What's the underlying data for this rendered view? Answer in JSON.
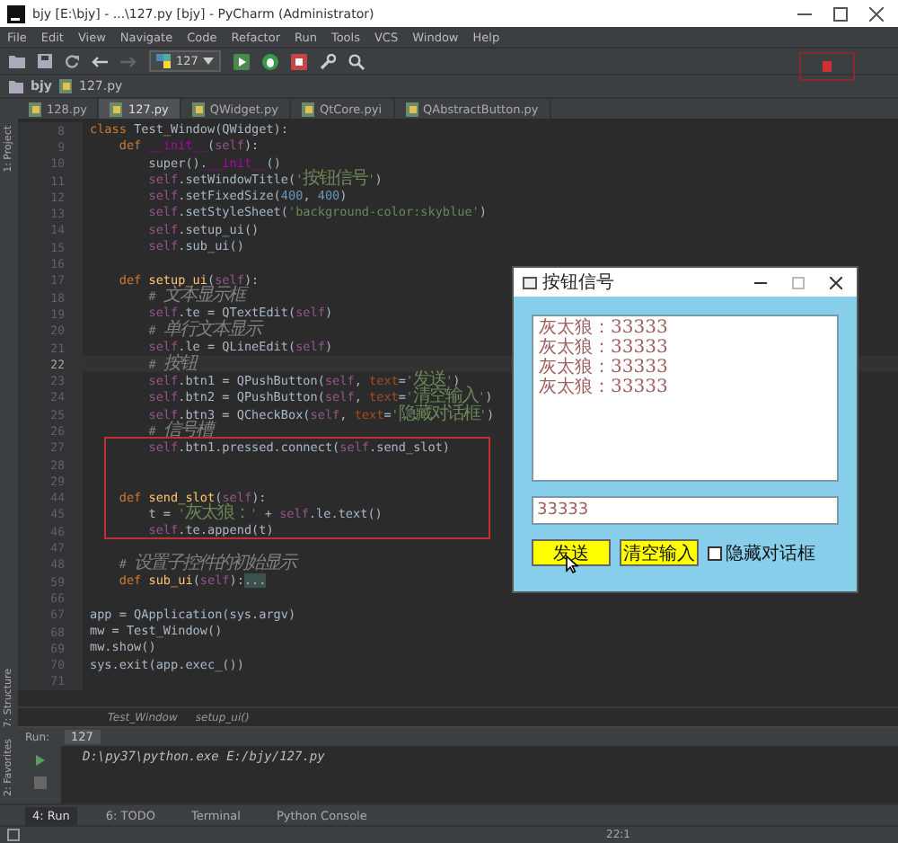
{
  "window": {
    "title": "bjy [E:\\bjy] - ...\\127.py [bjy] - PyCharm (Administrator)"
  },
  "menu": [
    "File",
    "Edit",
    "View",
    "Navigate",
    "Code",
    "Refactor",
    "Run",
    "Tools",
    "VCS",
    "Window",
    "Help"
  ],
  "toolbar": {
    "run_config": "127"
  },
  "navbar": [
    "bjy",
    "127.py"
  ],
  "tabs": [
    {
      "label": "128.py",
      "selected": false
    },
    {
      "label": "127.py",
      "selected": true
    },
    {
      "label": "QWidget.py",
      "selected": false
    },
    {
      "label": "QtCore.pyi",
      "selected": false
    },
    {
      "label": "QAbstractButton.py",
      "selected": false
    }
  ],
  "side_tools": [
    "1: Project",
    "7: Structure",
    "2: Favorites"
  ],
  "code": [
    {
      "num": "8",
      "current": false,
      "tokens": [
        {
          "kind": "kw",
          "text": "class "
        },
        {
          "kind": "plain",
          "text": "Test_Window(QWidget):"
        }
      ]
    },
    {
      "num": "9",
      "current": false,
      "tokens": [
        {
          "kind": "kw",
          "text": "    def "
        },
        {
          "kind": "magic",
          "text": "__init__"
        },
        {
          "kind": "plain",
          "text": "("
        },
        {
          "kind": "self",
          "text": "self"
        },
        {
          "kind": "plain",
          "text": "):"
        }
      ]
    },
    {
      "num": "10",
      "current": false,
      "tokens": [
        {
          "kind": "plain",
          "text": "        super()."
        },
        {
          "kind": "magic",
          "text": "__init__"
        },
        {
          "kind": "plain",
          "text": "()"
        }
      ]
    },
    {
      "num": "11",
      "current": false,
      "tokens": [
        {
          "kind": "self",
          "text": "        self"
        },
        {
          "kind": "plain",
          "text": ".setWindowTitle("
        },
        {
          "kind": "str",
          "text": "'按钮信号'"
        },
        {
          "kind": "plain",
          "text": ")"
        }
      ]
    },
    {
      "num": "12",
      "current": false,
      "tokens": [
        {
          "kind": "self",
          "text": "        self"
        },
        {
          "kind": "plain",
          "text": ".setFixedSize("
        },
        {
          "kind": "num",
          "text": "400"
        },
        {
          "kind": "plain",
          "text": ", "
        },
        {
          "kind": "num",
          "text": "400"
        },
        {
          "kind": "plain",
          "text": ")"
        }
      ]
    },
    {
      "num": "13",
      "current": false,
      "tokens": [
        {
          "kind": "self",
          "text": "        self"
        },
        {
          "kind": "plain",
          "text": ".setStyleSheet("
        },
        {
          "kind": "str",
          "text": "'background-color:skyblue'"
        },
        {
          "kind": "plain",
          "text": ")"
        }
      ]
    },
    {
      "num": "14",
      "current": false,
      "tokens": [
        {
          "kind": "self",
          "text": "        self"
        },
        {
          "kind": "plain",
          "text": ".setup_ui()"
        }
      ]
    },
    {
      "num": "15",
      "current": false,
      "tokens": [
        {
          "kind": "self",
          "text": "        self"
        },
        {
          "kind": "plain",
          "text": ".sub_ui()"
        }
      ]
    },
    {
      "num": "16",
      "current": false
    },
    {
      "num": "17",
      "current": false,
      "tokens": [
        {
          "kind": "kw",
          "text": "    def "
        },
        {
          "kind": "fn",
          "text": "setup_ui"
        },
        {
          "kind": "plain",
          "text": "("
        },
        {
          "kind": "self",
          "text": "self"
        },
        {
          "kind": "plain",
          "text": "):"
        }
      ]
    },
    {
      "num": "18",
      "current": false,
      "tokens": [
        {
          "kind": "cmt",
          "text": "        # 文本显示框"
        }
      ]
    },
    {
      "num": "19",
      "current": false,
      "tokens": [
        {
          "kind": "self",
          "text": "        self"
        },
        {
          "kind": "plain",
          "text": ".te = QTextEdit("
        },
        {
          "kind": "self",
          "text": "self"
        },
        {
          "kind": "plain",
          "text": ")"
        }
      ]
    },
    {
      "num": "20",
      "current": false,
      "tokens": [
        {
          "kind": "cmt",
          "text": "        # 单行文本显示"
        }
      ]
    },
    {
      "num": "21",
      "current": false,
      "tokens": [
        {
          "kind": "self",
          "text": "        self"
        },
        {
          "kind": "plain",
          "text": ".le = QLineEdit("
        },
        {
          "kind": "self",
          "text": "self"
        },
        {
          "kind": "plain",
          "text": ")"
        }
      ]
    },
    {
      "num": "22",
      "current": true,
      "tokens": [
        {
          "kind": "cmt",
          "text": "        # 按钮"
        }
      ]
    },
    {
      "num": "23",
      "current": false,
      "tokens": [
        {
          "kind": "self",
          "text": "        self"
        },
        {
          "kind": "plain",
          "text": ".btn1 = QPushButton("
        },
        {
          "kind": "self",
          "text": "self"
        },
        {
          "kind": "plain",
          "text": ", "
        },
        {
          "kind": "param",
          "text": "text"
        },
        {
          "kind": "plain",
          "text": "="
        },
        {
          "kind": "str",
          "text": "'发送'"
        },
        {
          "kind": "plain",
          "text": ")"
        }
      ]
    },
    {
      "num": "24",
      "current": false,
      "tokens": [
        {
          "kind": "self",
          "text": "        self"
        },
        {
          "kind": "plain",
          "text": ".btn2 = QPushButton("
        },
        {
          "kind": "self",
          "text": "self"
        },
        {
          "kind": "plain",
          "text": ", "
        },
        {
          "kind": "param",
          "text": "text"
        },
        {
          "kind": "plain",
          "text": "="
        },
        {
          "kind": "str",
          "text": "'清空输入'"
        },
        {
          "kind": "plain",
          "text": ")"
        }
      ]
    },
    {
      "num": "25",
      "current": false,
      "tokens": [
        {
          "kind": "self",
          "text": "        self"
        },
        {
          "kind": "plain",
          "text": ".btn3 = QCheckBox("
        },
        {
          "kind": "self",
          "text": "self"
        },
        {
          "kind": "plain",
          "text": ", "
        },
        {
          "kind": "param",
          "text": "text"
        },
        {
          "kind": "plain",
          "text": "="
        },
        {
          "kind": "str",
          "text": "'隐藏对话框'"
        },
        {
          "kind": "plain",
          "text": ")"
        }
      ]
    },
    {
      "num": "26",
      "current": false,
      "tokens": [
        {
          "kind": "cmt",
          "text": "        # 信号槽"
        }
      ]
    },
    {
      "num": "27",
      "current": false,
      "tokens": [
        {
          "kind": "self",
          "text": "        self"
        },
        {
          "kind": "plain",
          "text": ".btn1.pressed.connect("
        },
        {
          "kind": "self",
          "text": "self"
        },
        {
          "kind": "plain",
          "text": ".send_slot)"
        }
      ]
    },
    {
      "num": "28",
      "current": false
    },
    {
      "num": "29",
      "current": false
    },
    {
      "num": "44",
      "current": false,
      "tokens": [
        {
          "kind": "kw",
          "text": "    def "
        },
        {
          "kind": "fn",
          "text": "send_slot"
        },
        {
          "kind": "plain",
          "text": "("
        },
        {
          "kind": "self",
          "text": "self"
        },
        {
          "kind": "plain",
          "text": "):"
        }
      ]
    },
    {
      "num": "45",
      "current": false,
      "tokens": [
        {
          "kind": "plain",
          "text": "        t = "
        },
        {
          "kind": "str",
          "text": "'灰太狼：'"
        },
        {
          "kind": "plain",
          "text": " + "
        },
        {
          "kind": "self",
          "text": "self"
        },
        {
          "kind": "plain",
          "text": ".le.text()"
        }
      ]
    },
    {
      "num": "46",
      "current": false,
      "tokens": [
        {
          "kind": "self",
          "text": "        self"
        },
        {
          "kind": "plain",
          "text": ".te.append(t)"
        }
      ]
    },
    {
      "num": "47",
      "current": false
    },
    {
      "num": "48",
      "current": false,
      "tokens": [
        {
          "kind": "cmt",
          "text": "    # 设置子控件的初始显示"
        }
      ]
    },
    {
      "num": "59",
      "current": false,
      "tokens": [
        {
          "kind": "kw",
          "text": "    def "
        },
        {
          "kind": "fn",
          "text": "sub_ui"
        },
        {
          "kind": "plain",
          "text": "("
        },
        {
          "kind": "self",
          "text": "self"
        },
        {
          "kind": "plain",
          "text": "):"
        },
        {
          "kind": "fold",
          "text": "..."
        }
      ]
    },
    {
      "num": "66",
      "current": false
    },
    {
      "num": "67",
      "current": false,
      "tokens": [
        {
          "kind": "plain",
          "text": "app = QApplication(sys.argv)"
        }
      ]
    },
    {
      "num": "68",
      "current": false,
      "tokens": [
        {
          "kind": "plain",
          "text": "mw = Test_Window()"
        }
      ]
    },
    {
      "num": "69",
      "current": false,
      "tokens": [
        {
          "kind": "plain",
          "text": "mw.show()"
        }
      ]
    },
    {
      "num": "70",
      "current": false,
      "tokens": [
        {
          "kind": "plain",
          "text": "sys.exit(app.exec_())"
        }
      ]
    },
    {
      "num": "71",
      "current": false
    }
  ],
  "breadcrumb": [
    "Test_Window",
    "setup_ui()"
  ],
  "run_panel": {
    "label": "Run:",
    "tab": "127",
    "output": "D:\\py37\\python.exe E:/bjy/127.py"
  },
  "tool_tabs": [
    {
      "label": "4: Run",
      "selected": true
    },
    {
      "label": "6: TODO",
      "selected": false
    },
    {
      "label": "Terminal",
      "selected": false
    },
    {
      "label": "Python Console",
      "selected": false
    }
  ],
  "status_bar": {
    "time": "22:1"
  },
  "qt_window": {
    "title": "按钮信号",
    "text_lines": [
      "灰太狼：33333",
      "灰太狼：33333",
      "灰太狼：33333",
      "灰太狼：33333"
    ],
    "line_edit": "33333",
    "buttons": [
      "发送",
      "清空输入"
    ],
    "checkbox": {
      "label": "隐藏对话框",
      "checked": false
    }
  }
}
